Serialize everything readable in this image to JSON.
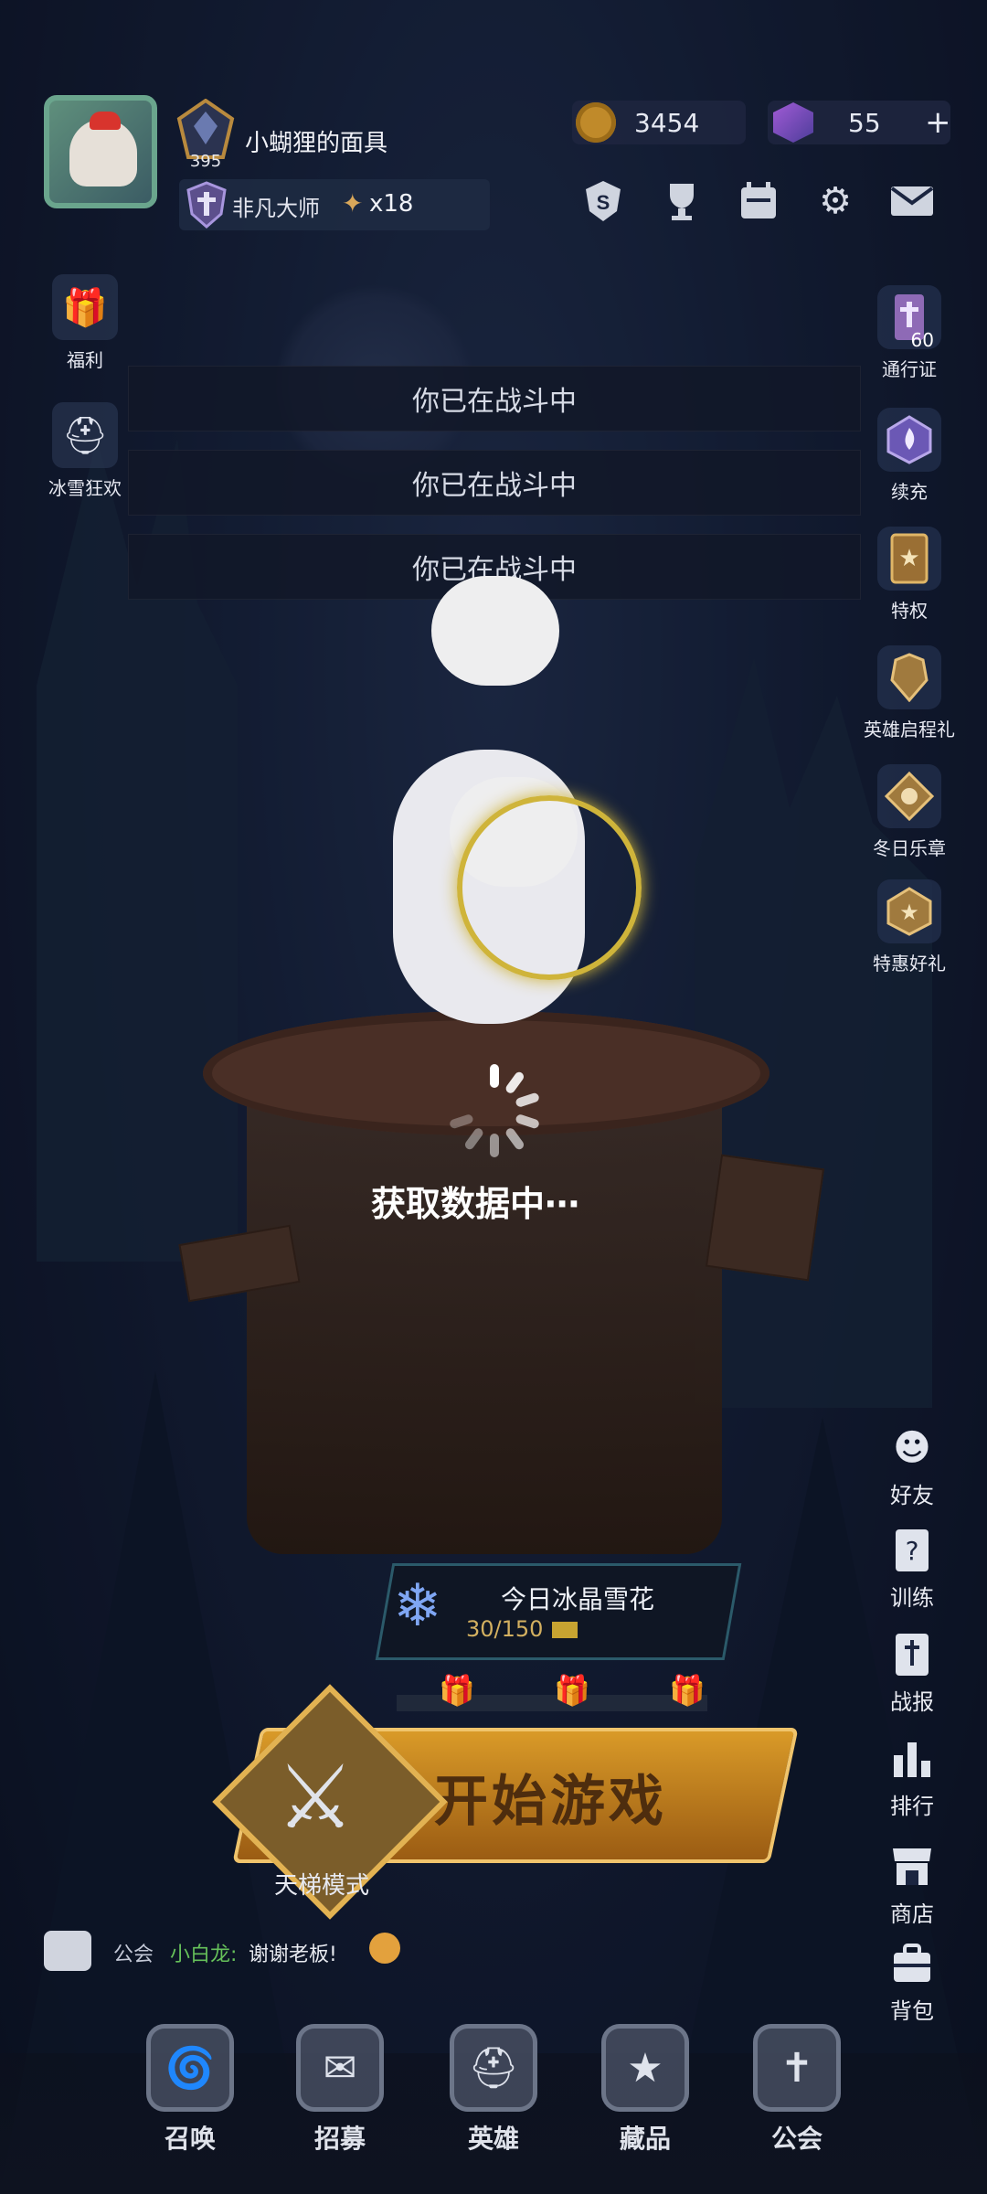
{
  "profile": {
    "nickname": "小蝴狸的面具",
    "level": "395",
    "rank_title": "非凡大师",
    "star_count": "x18"
  },
  "currencies": {
    "gold": "3454",
    "gems": "55",
    "add_symbol": "+"
  },
  "top_icons": [
    "s-shield-icon",
    "trophy-icon",
    "calendar-icon",
    "gear-icon",
    "mail-icon"
  ],
  "left_side": [
    {
      "label": "福利",
      "icon": "gift-icon"
    },
    {
      "label": "冰雪狂欢",
      "icon": "helmet-icon"
    }
  ],
  "toasts": [
    "你已在战斗中",
    "你已在战斗中",
    "你已在战斗中"
  ],
  "right_side": [
    {
      "label": "通行证",
      "icon": "pass-icon",
      "badge": "60"
    },
    {
      "label": "续充",
      "icon": "flame-badge-icon"
    },
    {
      "label": "特权",
      "icon": "card-star-icon"
    },
    {
      "label": "英雄启程礼",
      "icon": "armor-icon"
    },
    {
      "label": "冬日乐章",
      "icon": "diamond-badge-icon"
    },
    {
      "label": "特惠好礼",
      "icon": "star-badge-icon"
    }
  ],
  "loading": {
    "text": "获取数据中⋯"
  },
  "snowflake": {
    "title": "今日冰晶雪花",
    "progress": "30/150"
  },
  "start": {
    "label": "开始游戏",
    "mode": "天梯模式"
  },
  "chat": {
    "channel": "公会",
    "user": "小白龙:",
    "message": "谢谢老板!"
  },
  "right_lower": [
    {
      "label": "好友",
      "icon": "friends-icon"
    },
    {
      "label": "训练",
      "icon": "question-card-icon"
    },
    {
      "label": "战报",
      "icon": "report-icon"
    },
    {
      "label": "排行",
      "icon": "bar-chart-icon"
    },
    {
      "label": "商店",
      "icon": "shop-icon"
    },
    {
      "label": "背包",
      "icon": "backpack-icon"
    }
  ],
  "bottom_nav": [
    {
      "label": "召唤",
      "icon": "vortex-icon"
    },
    {
      "label": "招募",
      "icon": "recruit-icon"
    },
    {
      "label": "英雄",
      "icon": "helmet-icon"
    },
    {
      "label": "藏品",
      "icon": "collection-icon"
    },
    {
      "label": "公会",
      "icon": "guild-shield-icon"
    }
  ]
}
